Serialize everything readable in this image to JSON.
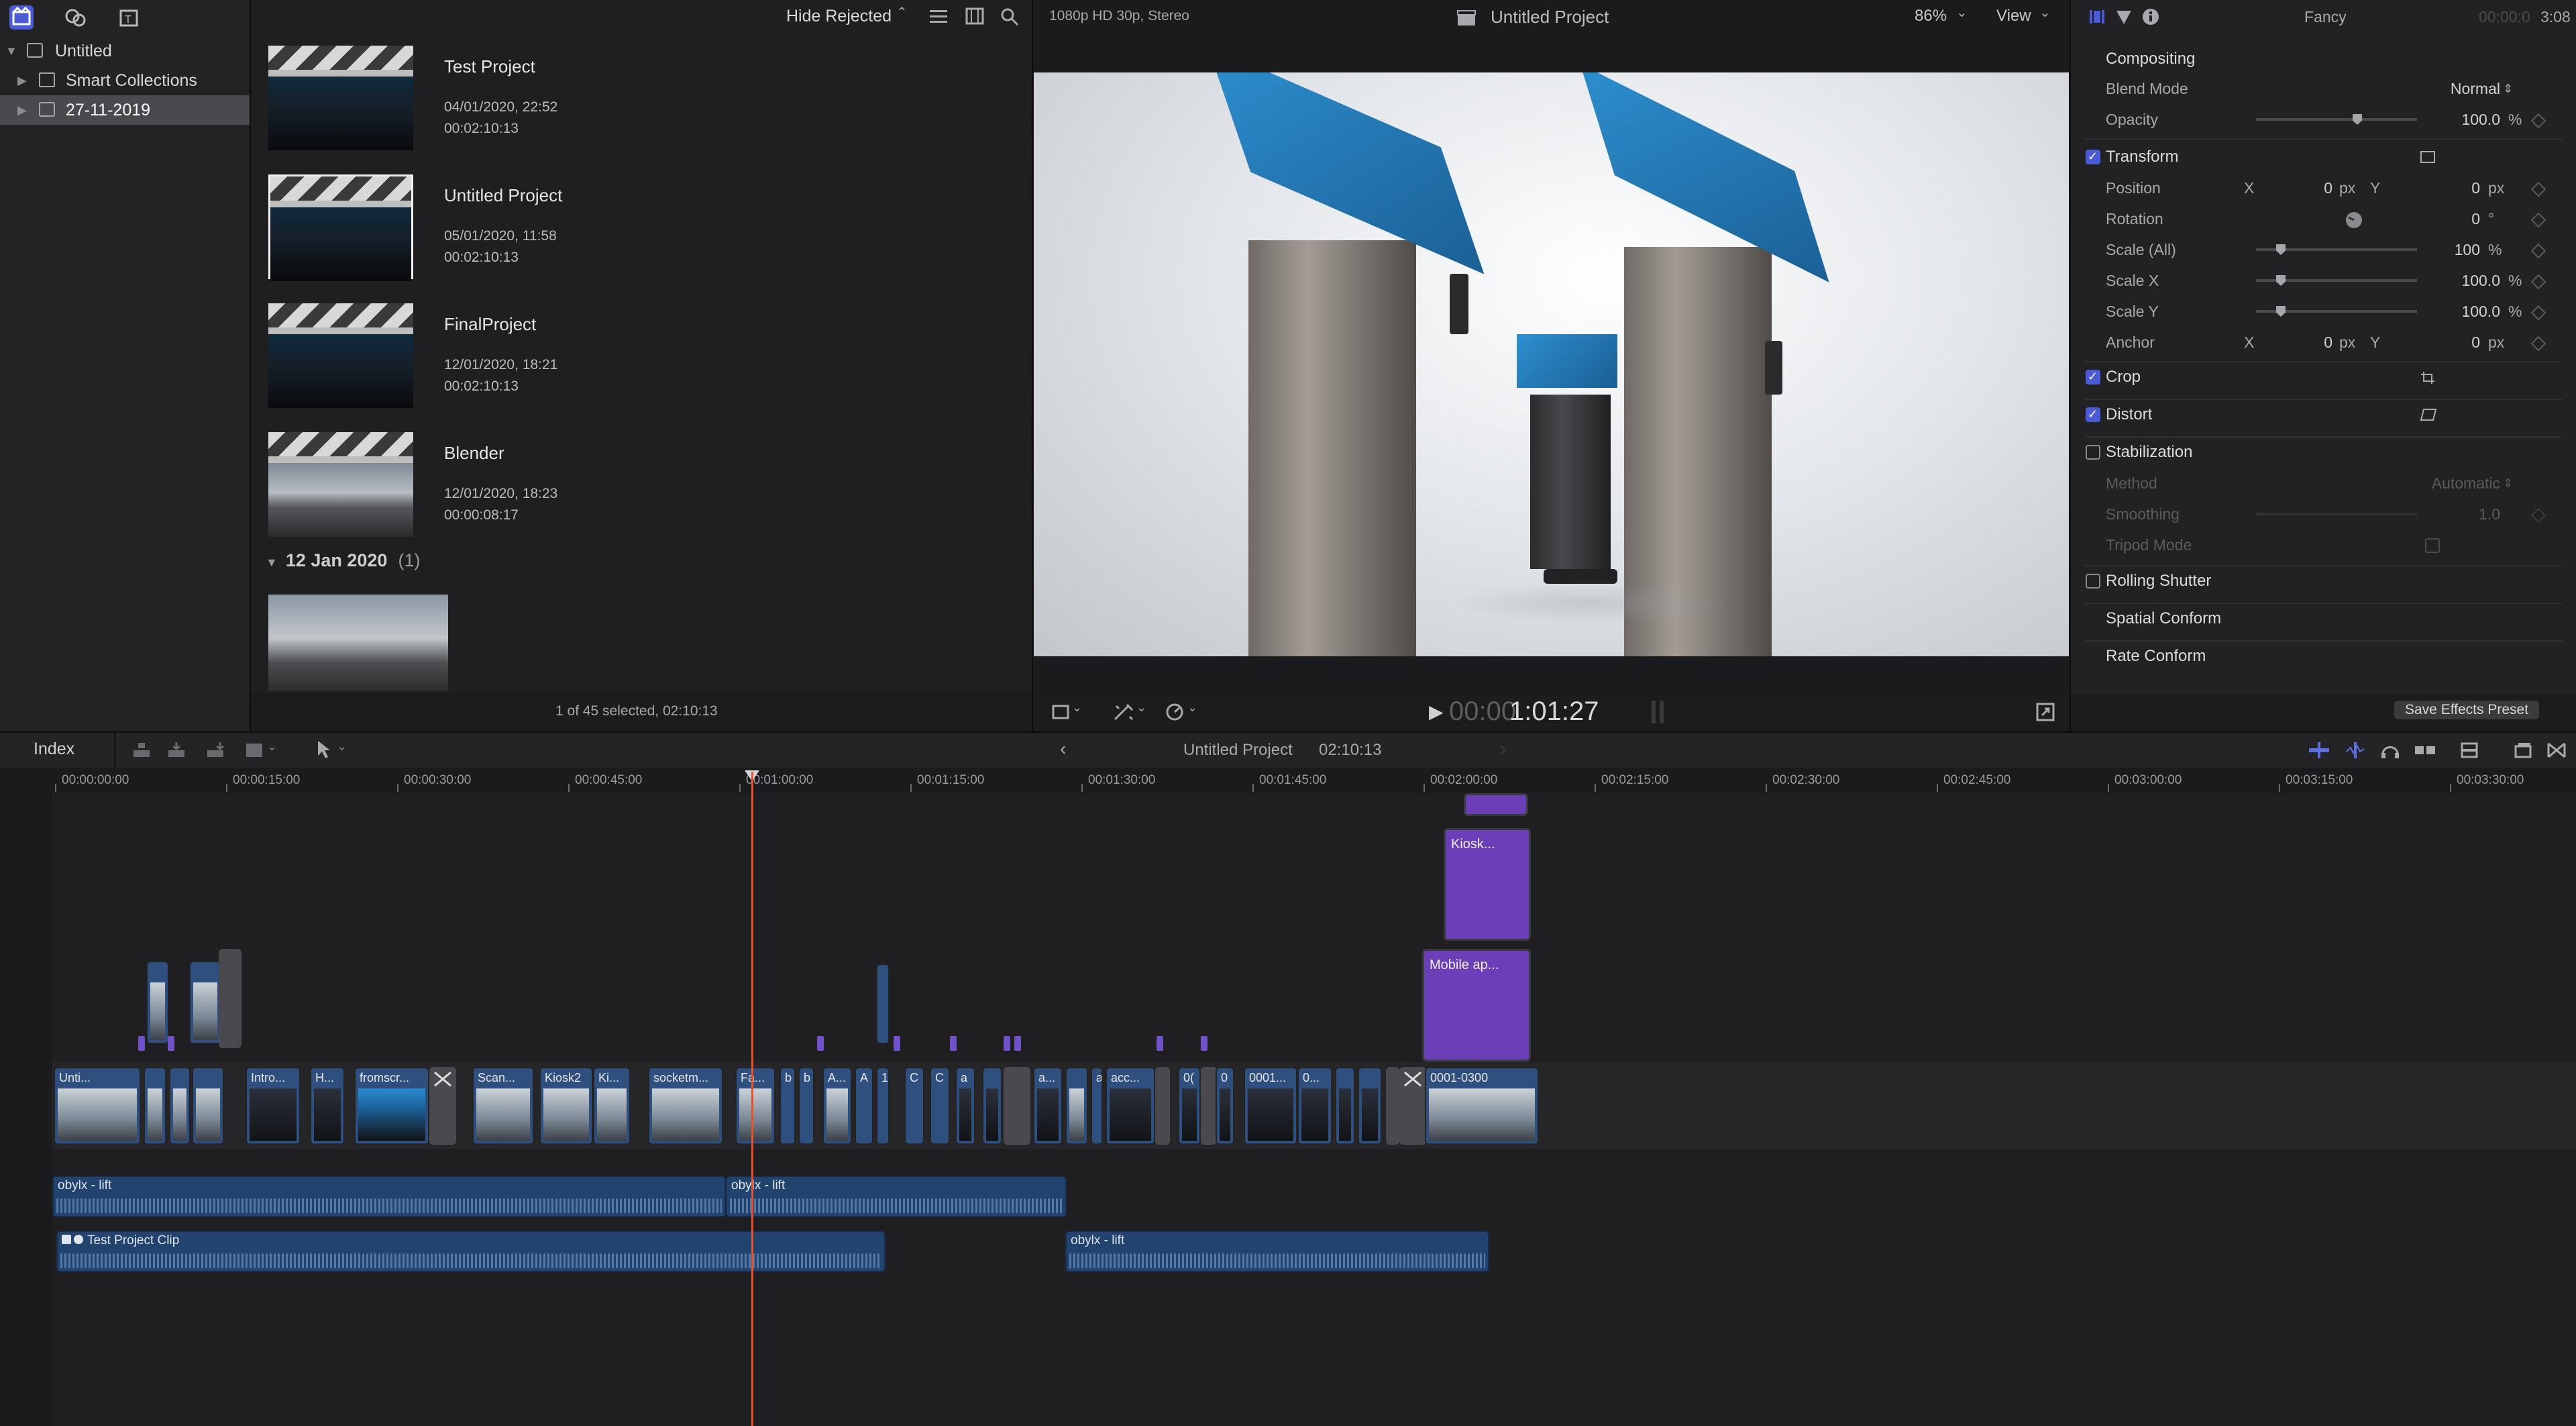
{
  "library": {
    "items": [
      {
        "label": "Untitled"
      },
      {
        "label": "Smart Collections"
      },
      {
        "label": "27-11-2019"
      }
    ]
  },
  "browser": {
    "filter_label": "Hide Rejected",
    "projects": [
      {
        "name": "Test Project",
        "date": "04/01/2020, 22:52",
        "duration": "00:02:10:13"
      },
      {
        "name": "Untitled Project",
        "date": "05/01/2020, 11:58",
        "duration": "00:02:10:13"
      },
      {
        "name": "FinalProject",
        "date": "12/01/2020, 18:21",
        "duration": "00:02:10:13"
      },
      {
        "name": "Blender",
        "date": "12/01/2020, 18:23",
        "duration": "00:00:08:17"
      }
    ],
    "group": {
      "date": "12 Jan 2020",
      "count": "(1)"
    },
    "status": "1 of 45 selected, 02:10:13"
  },
  "viewer": {
    "format": "1080p HD 30p, Stereo",
    "title": "Untitled Project",
    "zoom": "86%",
    "view_label": "View",
    "timecode_dim": "00:00",
    "timecode": "1:01:27"
  },
  "inspector": {
    "effect_name": "Fancy",
    "time_dim": "00:00:0",
    "time": "3:08",
    "compositing": "Compositing",
    "blend_mode_label": "Blend Mode",
    "blend_mode_value": "Normal",
    "opacity_label": "Opacity",
    "opacity_value": "100.0",
    "percent": "%",
    "transform": "Transform",
    "position_label": "Position",
    "x": "X",
    "y": "Y",
    "position_x": "0",
    "position_y": "0",
    "px": "px",
    "rotation_label": "Rotation",
    "rotation_value": "0",
    "degree": "°",
    "scale_all_label": "Scale (All)",
    "scale_all_value": "100",
    "scale_x_label": "Scale X",
    "scale_x_value": "100.0",
    "scale_y_label": "Scale Y",
    "scale_y_value": "100.0",
    "anchor_label": "Anchor",
    "anchor_x": "0",
    "anchor_y": "0",
    "crop": "Crop",
    "distort": "Distort",
    "stabilization": "Stabilization",
    "method_label": "Method",
    "method_value": "Automatic",
    "smoothing_label": "Smoothing",
    "smoothing_value": "1.0",
    "tripod_label": "Tripod Mode",
    "rolling_shutter": "Rolling Shutter",
    "spatial_conform": "Spatial Conform",
    "rate_conform": "Rate Conform",
    "save_preset": "Save Effects Preset"
  },
  "timeline": {
    "index_label": "Index",
    "project_name": "Untitled Project",
    "duration": "02:10:13",
    "ruler": [
      "00:00:00:00",
      "00:00:15:00",
      "00:00:30:00",
      "00:00:45:00",
      "00:01:00:00",
      "00:01:15:00",
      "00:01:30:00",
      "00:01:45:00",
      "00:02:00:00",
      "00:02:15:00",
      "00:02:30:00",
      "00:02:45:00",
      "00:03:00:00",
      "00:03:15:00",
      "00:03:30:00"
    ],
    "connected_clips": [
      "Kiosk...",
      "Mobile ap..."
    ],
    "primary_clips": [
      "Unti...",
      "Intro...",
      "H...",
      "fromscr...",
      "Scan...",
      "Kiosk2",
      "Ki...",
      "socketm...",
      "Fa...",
      "b",
      "b",
      "A...",
      "A",
      "1",
      "C",
      "C",
      "a",
      "a...",
      "a",
      "acc...",
      "0(",
      "0",
      "0001...",
      "0...",
      "0001-0300"
    ],
    "audio_clips": [
      "obylx - lift",
      "obylx - lift",
      "Test Project Clip",
      "obylx - lift"
    ]
  }
}
